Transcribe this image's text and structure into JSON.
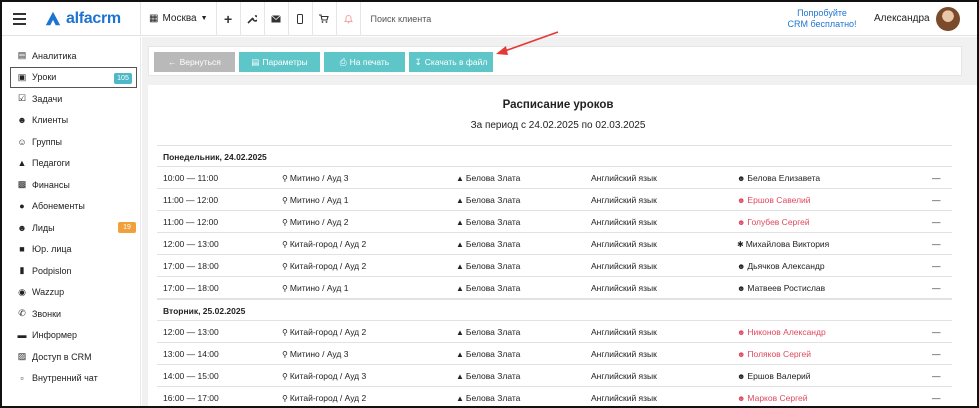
{
  "app": {
    "logo_text": "alfacrm"
  },
  "topbar": {
    "branch": "Москва",
    "search_placeholder": "Поиск клиента",
    "promo_line1": "Попробуйте",
    "promo_line2": "CRM бесплатно!",
    "user_name": "Александра"
  },
  "sidebar": {
    "items": [
      {
        "label": "Аналитика",
        "icon": "chart-icon"
      },
      {
        "label": "Уроки",
        "icon": "calendar-icon",
        "badge": "105",
        "active": true
      },
      {
        "label": "Задачи",
        "icon": "clipboard-icon"
      },
      {
        "label": "Клиенты",
        "icon": "user-icon"
      },
      {
        "label": "Группы",
        "icon": "users-icon"
      },
      {
        "label": "Педагоги",
        "icon": "graduation-cap-icon"
      },
      {
        "label": "Финансы",
        "icon": "money-icon"
      },
      {
        "label": "Абонементы",
        "icon": "ticket-icon"
      },
      {
        "label": "Лиды",
        "icon": "lead-icon",
        "badge": "19"
      },
      {
        "label": "Юр. лица",
        "icon": "briefcase-icon"
      },
      {
        "label": "Podpislon",
        "icon": "document-icon"
      },
      {
        "label": "Wazzup",
        "icon": "whatsapp-icon"
      },
      {
        "label": "Звонки",
        "icon": "phone-icon"
      },
      {
        "label": "Информер",
        "icon": "informer-icon"
      },
      {
        "label": "Доступ в CRM",
        "icon": "lock-icon"
      },
      {
        "label": "Внутренний чат",
        "icon": "chat-icon"
      }
    ]
  },
  "toolbar": {
    "back_label": "Вернуться",
    "params_label": "Параметры",
    "print_label": "На печать",
    "download_label": "Скачать в файл"
  },
  "document": {
    "title": "Расписание уроков",
    "subtitle": "За период с 24.02.2025 по 02.03.2025"
  },
  "schedule": {
    "day1": {
      "label": "Понедельник, 24.02.2025",
      "rows": [
        {
          "time": "10:00 — 11:00",
          "room": "Митино / Ауд 3",
          "teacher": "Белова Злата",
          "subject": "Английский язык",
          "client": "Белова Елизавета",
          "mark": "—"
        },
        {
          "time": "11:00 — 12:00",
          "room": "Митино / Ауд 1",
          "teacher": "Белова Злата",
          "subject": "Английский язык",
          "client": "Ершов Савелий",
          "mark": "—"
        },
        {
          "time": "11:00 — 12:00",
          "room": "Митино / Ауд 2",
          "teacher": "Белова Злата",
          "subject": "Английский язык",
          "client": "Голубев Сергей",
          "mark": "—"
        },
        {
          "time": "12:00 — 13:00",
          "room": "Китай-город / Ауд 2",
          "teacher": "Белова Злата",
          "subject": "Английский язык",
          "client": "Михайлова Виктория",
          "mark": "—"
        },
        {
          "time": "17:00 — 18:00",
          "room": "Китай-город / Ауд 2",
          "teacher": "Белова Злата",
          "subject": "Английский язык",
          "client": "Дьячков Александр",
          "mark": "—"
        },
        {
          "time": "17:00 — 18:00",
          "room": "Митино / Ауд 1",
          "teacher": "Белова Злата",
          "subject": "Английский язык",
          "client": "Матвеев Ростислав",
          "mark": "—"
        }
      ]
    },
    "day2": {
      "label": "Вторник, 25.02.2025",
      "rows": [
        {
          "time": "12:00 — 13:00",
          "room": "Китай-город / Ауд 2",
          "teacher": "Белова Злата",
          "subject": "Английский язык",
          "client": "Никонов Александр",
          "mark": "—"
        },
        {
          "time": "13:00 — 14:00",
          "room": "Митино / Ауд 3",
          "teacher": "Белова Злата",
          "subject": "Английский язык",
          "client": "Поляков Сергей",
          "mark": "—"
        },
        {
          "time": "14:00 — 15:00",
          "room": "Китай-город / Ауд 3",
          "teacher": "Белова Злата",
          "subject": "Английский язык",
          "client": "Ершов Валерий",
          "mark": "—"
        },
        {
          "time": "16:00 — 17:00",
          "room": "Китай-город / Ауд 2",
          "teacher": "Белова Злата",
          "subject": "Английский язык",
          "client": "Марков Сергей",
          "mark": "—"
        }
      ]
    }
  },
  "colors": {
    "brand_blue": "#1e74d2",
    "teal_button": "#5ec6c8",
    "gray_button": "#b9b9b9",
    "debt_red": "#e0485c",
    "arrow_red": "#e53935"
  }
}
